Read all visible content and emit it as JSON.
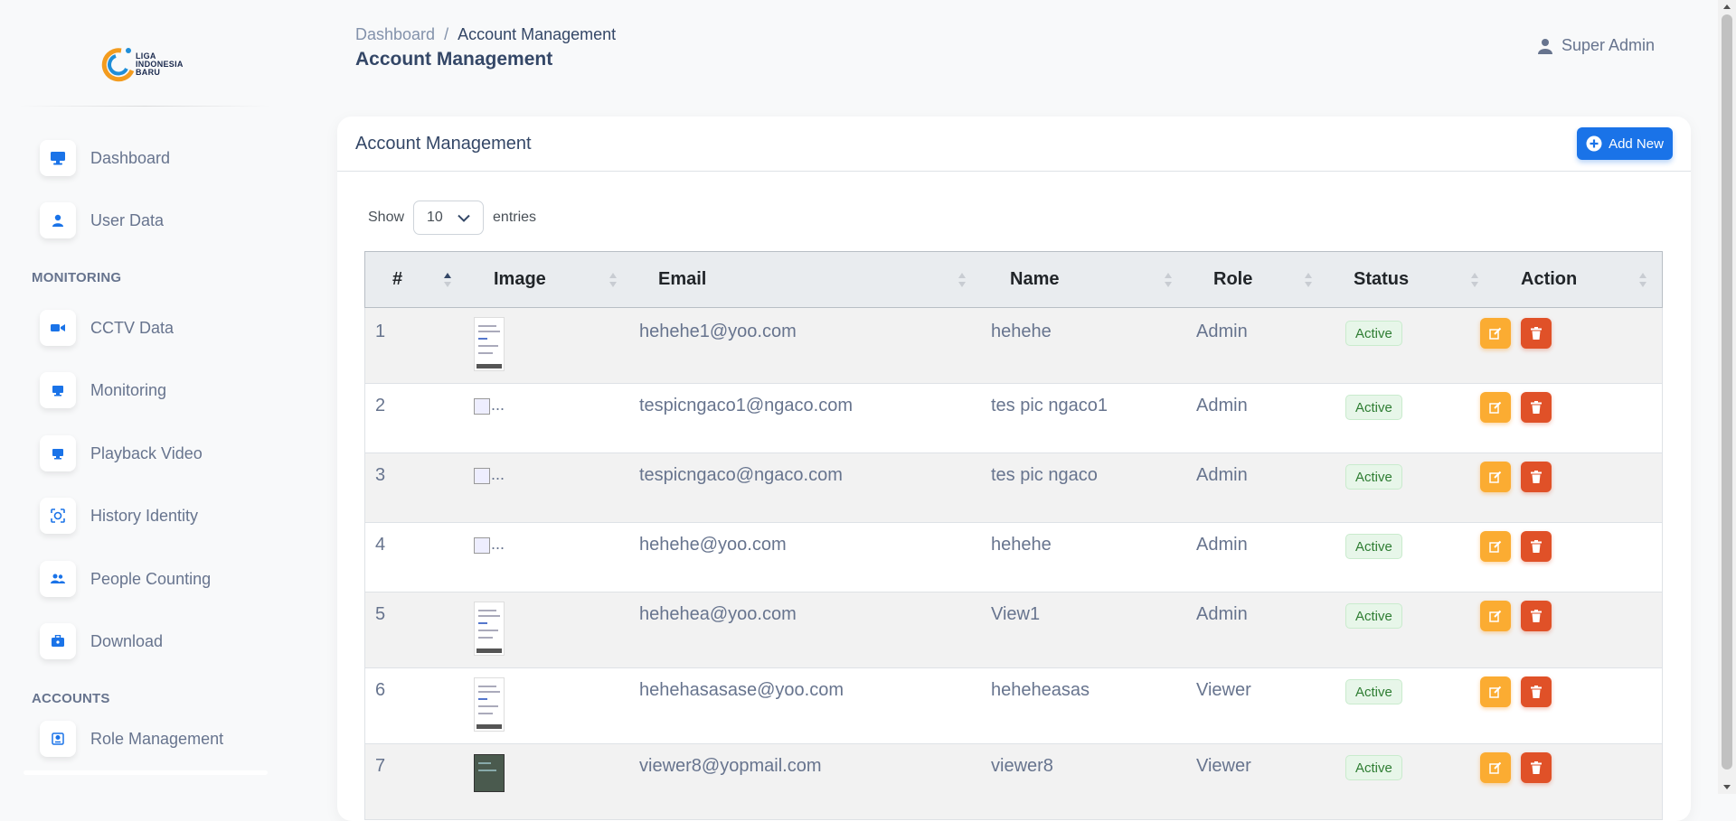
{
  "logo": {
    "line1": "LIGA",
    "line2": "INDONESIA",
    "line3": "BARU"
  },
  "sidebar": {
    "items": [
      {
        "label": "Dashboard",
        "icon": "monitor-icon"
      },
      {
        "label": "User Data",
        "icon": "user-icon"
      }
    ],
    "monitoring_title": "MONITORING",
    "monitoring_items": [
      {
        "label": "CCTV Data",
        "icon": "video-camera-icon"
      },
      {
        "label": "Monitoring",
        "icon": "monitor-icon"
      },
      {
        "label": "Playback Video",
        "icon": "monitor-icon"
      },
      {
        "label": "History Identity",
        "icon": "face-scan-icon"
      },
      {
        "label": "People Counting",
        "icon": "users-icon"
      },
      {
        "label": "Download",
        "icon": "download-briefcase-icon"
      }
    ],
    "accounts_title": "ACCOUNTS",
    "accounts_items": [
      {
        "label": "Role Management",
        "icon": "id-card-icon"
      }
    ]
  },
  "header": {
    "breadcrumb_root": "Dashboard",
    "breadcrumb_sep": "/",
    "breadcrumb_current": "Account Management",
    "title": "Account Management",
    "user_name": "Super Admin"
  },
  "card": {
    "title": "Account Management",
    "add_label": "Add New",
    "show_label": "Show",
    "entries_value": "10",
    "entries_label": "entries"
  },
  "table": {
    "columns": [
      "#",
      "Image",
      "Email",
      "Name",
      "Role",
      "Status",
      "Action"
    ],
    "rows": [
      {
        "no": "1",
        "image": "screenshot",
        "email": "hehehe1@yoo.com",
        "name": "hehehe",
        "role": "Admin",
        "status": "Active"
      },
      {
        "no": "2",
        "image": "broken",
        "image_alt": "...",
        "email": "tespicngaco1@ngaco.com",
        "name": "tes pic ngaco1",
        "role": "Admin",
        "status": "Active"
      },
      {
        "no": "3",
        "image": "broken",
        "image_alt": "...",
        "email": "tespicngaco@ngaco.com",
        "name": "tes pic ngaco",
        "role": "Admin",
        "status": "Active"
      },
      {
        "no": "4",
        "image": "broken",
        "image_alt": "...",
        "email": "hehehe@yoo.com",
        "name": "hehehe",
        "role": "Admin",
        "status": "Active"
      },
      {
        "no": "5",
        "image": "screenshot",
        "email": "hehehea@yoo.com",
        "name": "View1",
        "role": "Admin",
        "status": "Active"
      },
      {
        "no": "6",
        "image": "screenshot",
        "email": "hehehasasase@yoo.com",
        "name": "heheheasas",
        "role": "Viewer",
        "status": "Active"
      },
      {
        "no": "7",
        "image": "dark",
        "email": "viewer8@yopmail.com",
        "name": "viewer8",
        "role": "Viewer",
        "status": "Active"
      }
    ]
  },
  "colors": {
    "primary": "#1a73e8",
    "edit": "#fbac32",
    "delete": "#e05128",
    "active_badge": "#2e7d32"
  }
}
